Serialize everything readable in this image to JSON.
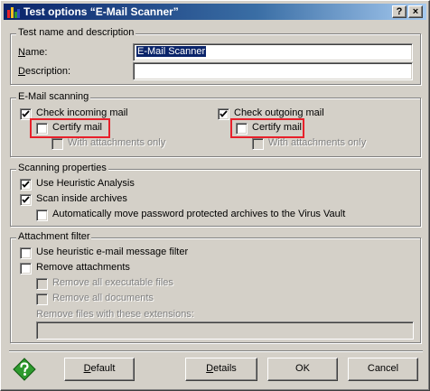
{
  "window": {
    "title": "Test options “E-Mail Scanner”",
    "help_button": "?",
    "close_button": "×"
  },
  "test_name": {
    "legend": "Test name and description",
    "name_label": "Name:",
    "name_value": "E-Mail Scanner",
    "description_label": "Description:",
    "description_value": ""
  },
  "email_scanning": {
    "legend": "E-Mail scanning",
    "incoming": {
      "label": "Check incoming mail",
      "checked": true
    },
    "incoming_certify": {
      "label": "Certify mail",
      "checked": false
    },
    "incoming_attachments": {
      "label": "With attachments only",
      "checked": false,
      "enabled": false
    },
    "outgoing": {
      "label": "Check outgoing mail",
      "checked": true
    },
    "outgoing_certify": {
      "label": "Certify mail",
      "checked": false
    },
    "outgoing_attachments": {
      "label": "With attachments only",
      "checked": false,
      "enabled": false
    }
  },
  "scanning_properties": {
    "legend": "Scanning properties",
    "heuristic": {
      "label": "Use Heuristic Analysis",
      "checked": true
    },
    "archives": {
      "label": "Scan inside archives",
      "checked": true
    },
    "move_protected": {
      "label": "Automatically move password protected archives to the Virus Vault",
      "checked": false
    }
  },
  "attachment_filter": {
    "legend": "Attachment filter",
    "heuristic_filter": {
      "label": "Use heuristic e-mail message filter",
      "checked": false
    },
    "remove_attachments": {
      "label": "Remove attachments",
      "checked": false
    },
    "remove_executables": {
      "label": "Remove all executable files",
      "checked": false,
      "enabled": false
    },
    "remove_documents": {
      "label": "Remove all documents",
      "checked": false,
      "enabled": false
    },
    "extensions_label": "Remove files with these extensions:",
    "extensions_value": ""
  },
  "buttons": {
    "default": "Default",
    "details": "Details",
    "ok": "OK",
    "cancel": "Cancel"
  },
  "colors": {
    "titlebar_start": "#0a246a",
    "titlebar_end": "#a6caf0",
    "highlight": "#e8202a",
    "help_green": "#2e9a2e"
  }
}
